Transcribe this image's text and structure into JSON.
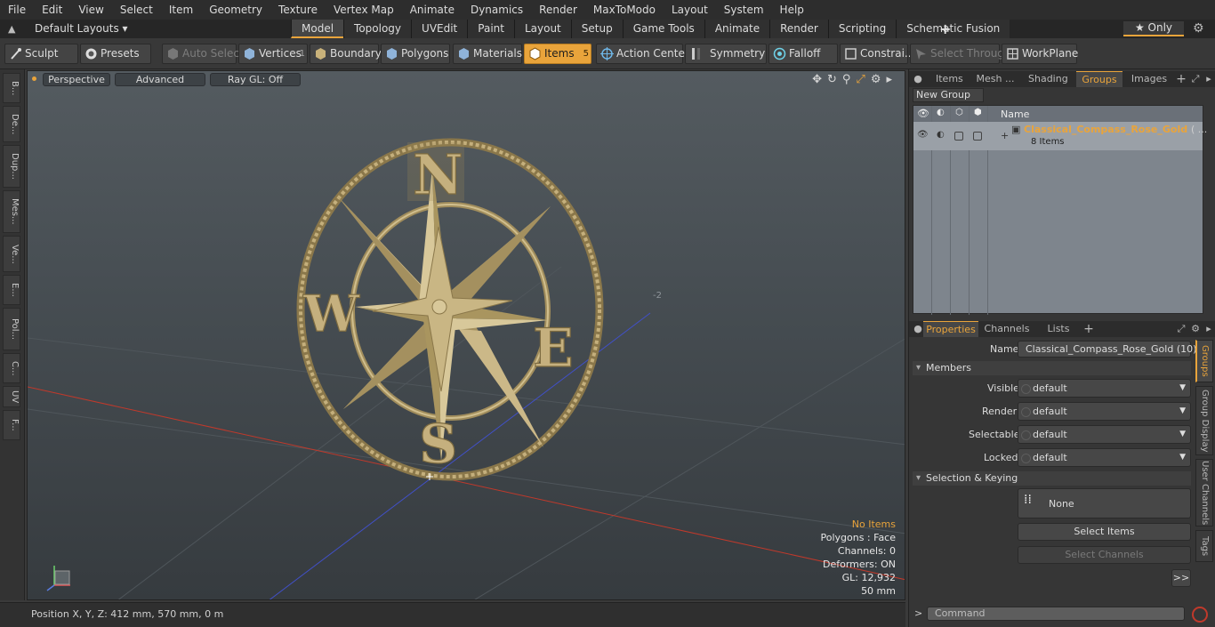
{
  "menu": [
    "File",
    "Edit",
    "View",
    "Select",
    "Item",
    "Geometry",
    "Texture",
    "Vertex Map",
    "Animate",
    "Dynamics",
    "Render",
    "MaxToModo",
    "Layout",
    "System",
    "Help"
  ],
  "layouts_label": "Default Layouts ▾",
  "mode_tabs": [
    {
      "label": "Model",
      "active": true
    },
    {
      "label": "Topology"
    },
    {
      "label": "UVEdit"
    },
    {
      "label": "Paint"
    },
    {
      "label": "Layout"
    },
    {
      "label": "Setup"
    },
    {
      "label": "Game Tools"
    },
    {
      "label": "Animate"
    },
    {
      "label": "Render"
    },
    {
      "label": "Scripting"
    },
    {
      "label": "Schematic Fusion"
    }
  ],
  "only_label": "★  Only",
  "toolbar": {
    "sculpt": "Sculpt",
    "presets": "Presets",
    "auto_select": "Auto Select",
    "vertices": "Vertices",
    "vertices_count": "1",
    "boundary": "Boundary",
    "polygons": "Polygons",
    "materials": "Materials",
    "items": "Items",
    "items_count": "5",
    "action_center": "Action Center",
    "symmetry": "Symmetry",
    "falloff": "Falloff",
    "constraints": "Constrai...",
    "select_through": "Select Through",
    "workplane": "WorkPlane"
  },
  "left_strip": [
    "B...",
    "De...",
    "Dup...",
    "Mes...",
    "Ve...",
    "E...",
    "Pol...",
    "C...",
    "UV",
    "F..."
  ],
  "viewport": {
    "perspective": "Perspective",
    "advanced": "Advanced",
    "raygl": "Ray GL: Off",
    "axis_tick": "-2",
    "compass_letters": {
      "n": "N",
      "e": "E",
      "s": "S",
      "w": "W"
    },
    "info": {
      "no_items": "No Items",
      "polygons": "Polygons : Face",
      "channels": "Channels: 0",
      "deformers": "Deformers: ON",
      "gl": "GL: 12,932",
      "scale": "50 mm"
    }
  },
  "status": {
    "position": "Position X, Y, Z:   412 mm, 570 mm, 0 m"
  },
  "right_tabs": [
    "Items",
    "Mesh ...",
    "Shading",
    "Groups",
    "Images"
  ],
  "right_tab_plus": "+",
  "groups": {
    "new_group": "New Group",
    "col_name": "Name",
    "row_name": "Classical_Compass_Rose_Gold",
    "row_name_suffix": "( ...",
    "row_sub": "8 Items"
  },
  "props_tabs": [
    "Properties",
    "Channels",
    "Lists"
  ],
  "props_plus": "+",
  "properties": {
    "name_label": "Name",
    "name_value": "Classical_Compass_Rose_Gold (10)",
    "members": "Members",
    "visible_label": "Visible",
    "render_label": "Render",
    "selectable_label": "Selectable",
    "locked_label": "Locked",
    "default_value": "default",
    "selection_keying": "Selection & Keying",
    "none_label": "None",
    "select_items": "Select Items",
    "select_channels": "Select Channels",
    "more": ">>"
  },
  "side_vtabs": [
    "Groups",
    "Group Display",
    "User Channels",
    "Tags"
  ],
  "command": {
    "prompt": ">",
    "placeholder": "Command"
  },
  "colors": {
    "accent": "#e9a43b",
    "gold": "#b5a06e",
    "gold_dark": "#8a774a",
    "gold_light": "#d8c89a"
  }
}
